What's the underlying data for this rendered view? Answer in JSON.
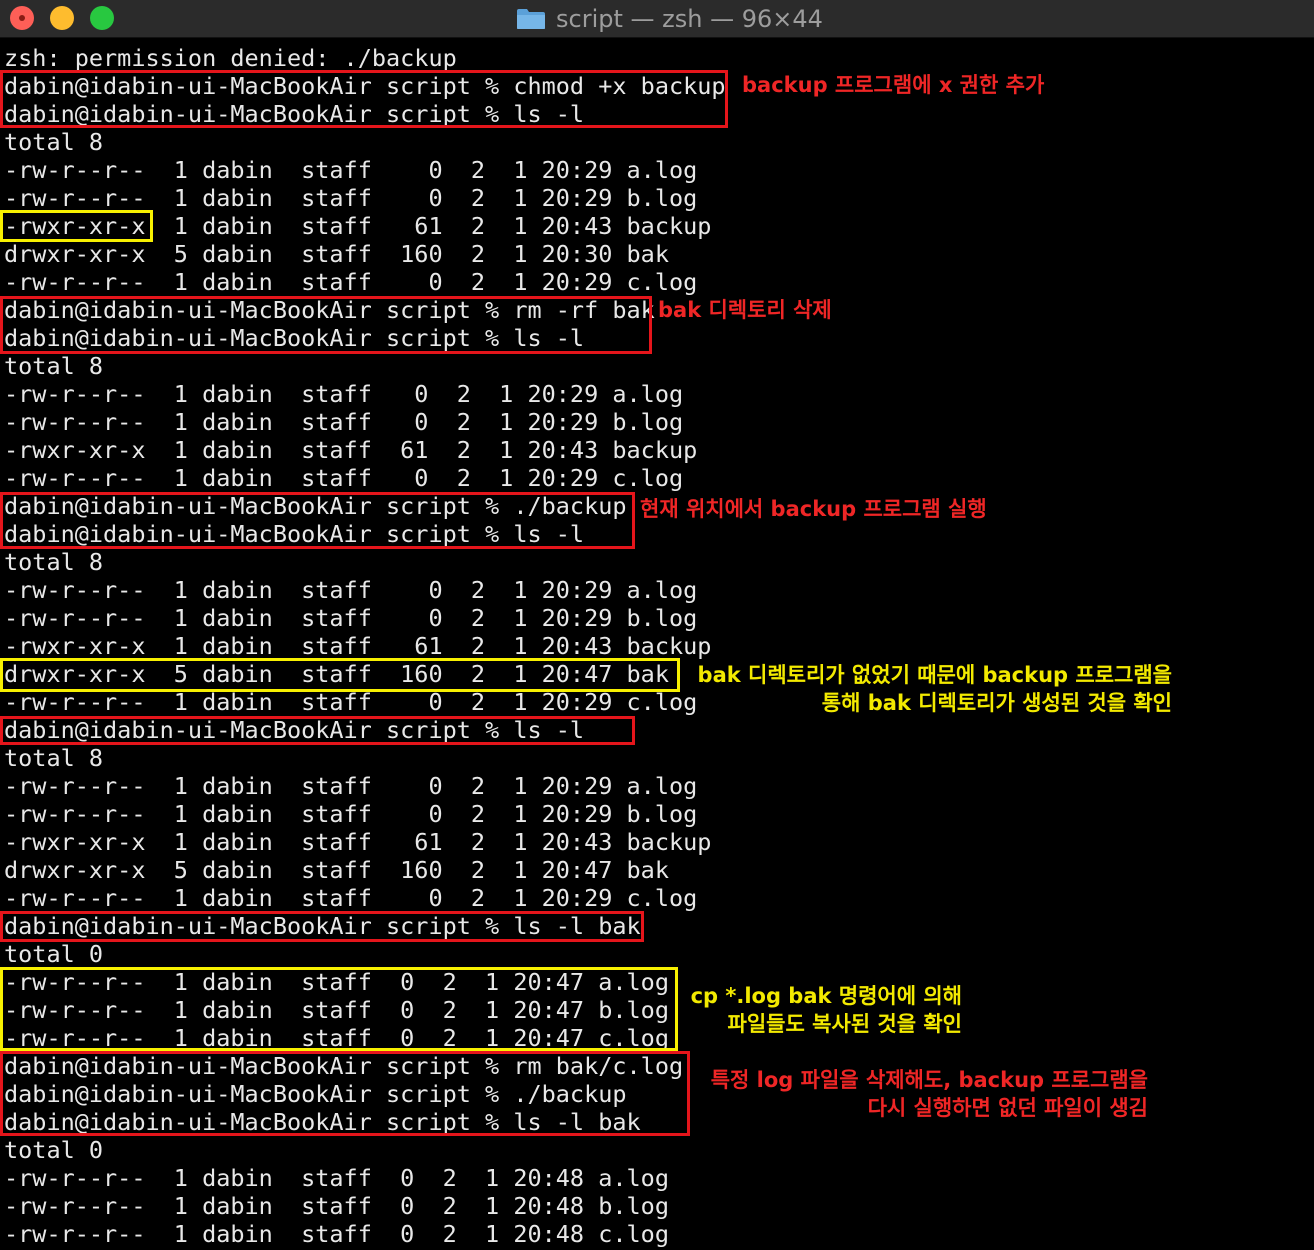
{
  "window": {
    "title": "script — zsh — 96×44",
    "colors": {
      "red": "#fe5f57",
      "yellow": "#febc2e",
      "green": "#28c840",
      "folder": "#5ba0d8"
    }
  },
  "terminal": {
    "lines": [
      "zsh: permission denied: ./backup",
      "dabin@idabin-ui-MacBookAir script % chmod +x backup",
      "dabin@idabin-ui-MacBookAir script % ls -l",
      "total 8",
      "-rw-r--r--  1 dabin  staff    0  2  1 20:29 a.log",
      "-rw-r--r--  1 dabin  staff    0  2  1 20:29 b.log",
      "-rwxr-xr-x  1 dabin  staff   61  2  1 20:43 backup",
      "drwxr-xr-x  5 dabin  staff  160  2  1 20:30 bak",
      "-rw-r--r--  1 dabin  staff    0  2  1 20:29 c.log",
      "dabin@idabin-ui-MacBookAir script % rm -rf bak",
      "dabin@idabin-ui-MacBookAir script % ls -l",
      "total 8",
      "-rw-r--r--  1 dabin  staff   0  2  1 20:29 a.log",
      "-rw-r--r--  1 dabin  staff   0  2  1 20:29 b.log",
      "-rwxr-xr-x  1 dabin  staff  61  2  1 20:43 backup",
      "-rw-r--r--  1 dabin  staff   0  2  1 20:29 c.log",
      "dabin@idabin-ui-MacBookAir script % ./backup",
      "dabin@idabin-ui-MacBookAir script % ls -l",
      "total 8",
      "-rw-r--r--  1 dabin  staff    0  2  1 20:29 a.log",
      "-rw-r--r--  1 dabin  staff    0  2  1 20:29 b.log",
      "-rwxr-xr-x  1 dabin  staff   61  2  1 20:43 backup",
      "drwxr-xr-x  5 dabin  staff  160  2  1 20:47 bak",
      "-rw-r--r--  1 dabin  staff    0  2  1 20:29 c.log",
      "dabin@idabin-ui-MacBookAir script % ls -l",
      "total 8",
      "-rw-r--r--  1 dabin  staff    0  2  1 20:29 a.log",
      "-rw-r--r--  1 dabin  staff    0  2  1 20:29 b.log",
      "-rwxr-xr-x  1 dabin  staff   61  2  1 20:43 backup",
      "drwxr-xr-x  5 dabin  staff  160  2  1 20:47 bak",
      "-rw-r--r--  1 dabin  staff    0  2  1 20:29 c.log",
      "dabin@idabin-ui-MacBookAir script % ls -l bak",
      "total 0",
      "-rw-r--r--  1 dabin  staff  0  2  1 20:47 a.log",
      "-rw-r--r--  1 dabin  staff  0  2  1 20:47 b.log",
      "-rw-r--r--  1 dabin  staff  0  2  1 20:47 c.log",
      "dabin@idabin-ui-MacBookAir script % rm bak/c.log",
      "dabin@idabin-ui-MacBookAir script % ./backup",
      "dabin@idabin-ui-MacBookAir script % ls -l bak",
      "total 0",
      "-rw-r--r--  1 dabin  staff  0  2  1 20:48 a.log",
      "-rw-r--r--  1 dabin  staff  0  2  1 20:48 b.log",
      "-rw-r--r--  1 dabin  staff  0  2  1 20:48 c.log"
    ]
  },
  "annotations": {
    "chmod": "backup 프로그램에 x 권한 추가",
    "rm_bak": "bak 디렉토리 삭제",
    "run_backup": "현재 위치에서 backup 프로그램 실행",
    "bak_created": "bak 디렉토리가 없었기 때문에 backup 프로그램을\n통해 bak 디렉토리가 생성된 것을 확인",
    "cp_logs": "cp *.log bak 명령어에 의해\n파일들도 복사된 것을 확인",
    "restore": "특정 log 파일을 삭제해도, backup 프로그램을\n다시 실행하면 없던 파일이 생김"
  },
  "annotation_colors": {
    "red": "#e5151b",
    "yellow": "#f7f000"
  }
}
